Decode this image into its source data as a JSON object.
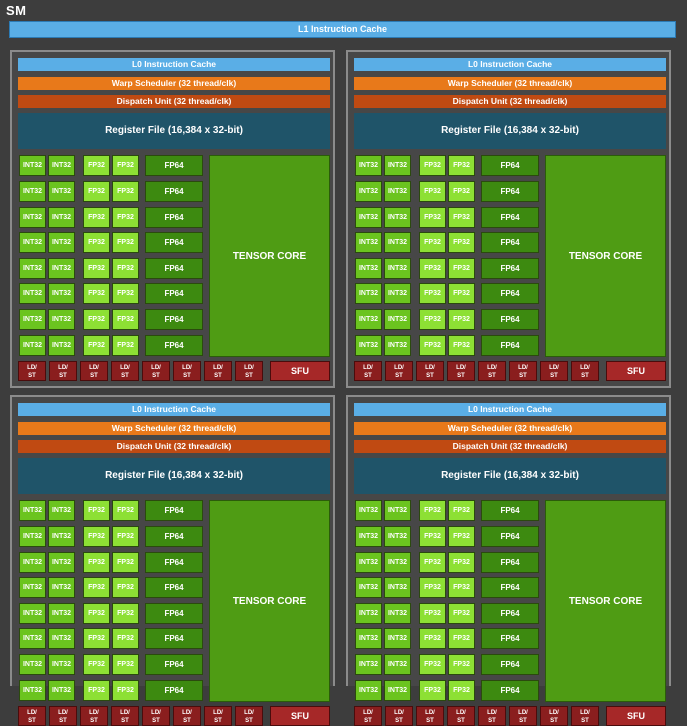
{
  "sm_label": "SM",
  "l1_cache": "L1 Instruction Cache",
  "partition": {
    "l0_cache": "L0 Instruction Cache",
    "warp_scheduler": "Warp Scheduler (32 thread/clk)",
    "dispatch_unit": "Dispatch Unit (32 thread/clk)",
    "register_file": "Register File (16,384 x 32-bit)",
    "int32": "INT32",
    "fp32": "FP32",
    "fp64": "FP64",
    "tensor_core": "TENSOR CORE",
    "ld_st_top": "LD/",
    "ld_st_bottom": "ST",
    "sfu": "SFU"
  },
  "partition_count": 4,
  "rows_per_partition": 8,
  "ld_st_units": 8,
  "colors": {
    "cache": "#5aaee6",
    "warp": "#e8791a",
    "dispatch": "#c04a12",
    "register": "#1f5469",
    "int32": "#6bc41f",
    "fp32": "#8de034",
    "fp64": "#3d8a10",
    "tensor": "#4f9c14",
    "ldst": "#8a1e1e"
  }
}
